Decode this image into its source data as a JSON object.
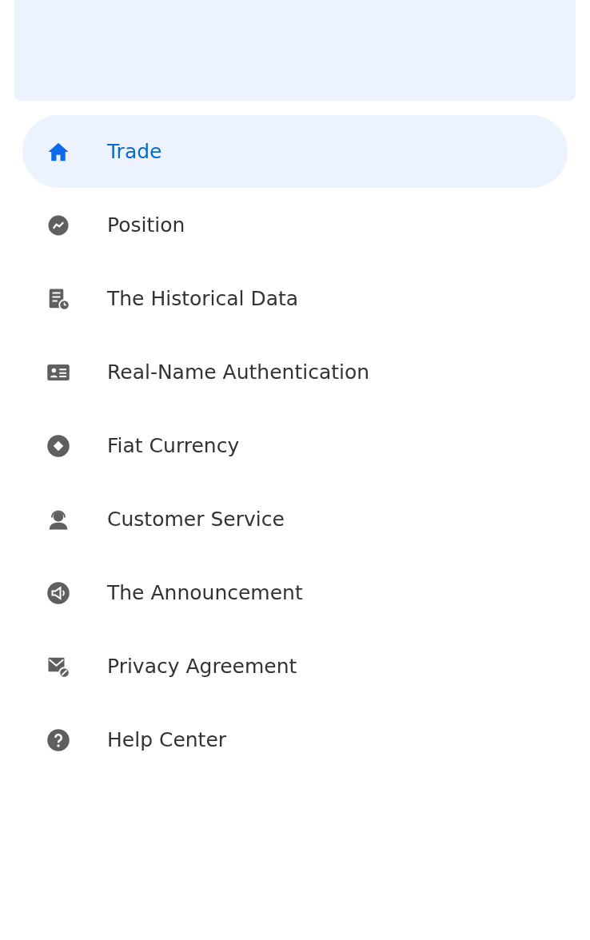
{
  "menu": {
    "items": [
      {
        "label": "Trade",
        "kind": "home",
        "selected": true
      },
      {
        "label": "Position",
        "kind": "trend",
        "selected": false
      },
      {
        "label": "The Historical Data",
        "kind": "history",
        "selected": false
      },
      {
        "label": "Real-Name Authentication",
        "kind": "idcard",
        "selected": false
      },
      {
        "label": "Fiat Currency",
        "kind": "coin",
        "selected": false
      },
      {
        "label": "Customer Service",
        "kind": "headset",
        "selected": false
      },
      {
        "label": "The Announcement",
        "kind": "speaker",
        "selected": false
      },
      {
        "label": "Privacy Agreement",
        "kind": "mail",
        "selected": false
      },
      {
        "label": "Help Center",
        "kind": "help",
        "selected": false
      }
    ]
  }
}
